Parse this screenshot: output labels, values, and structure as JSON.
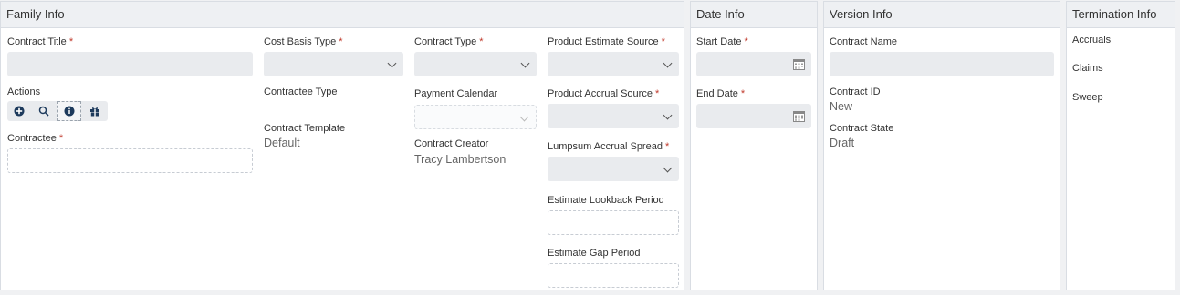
{
  "family": {
    "title": "Family Info",
    "contract_title_label": "Contract Title",
    "actions_label": "Actions",
    "contractee_label": "Contractee",
    "cost_basis_type_label": "Cost Basis Type",
    "contractee_type_label": "Contractee Type",
    "contractee_type_value": "-",
    "contract_template_label": "Contract Template",
    "contract_template_value": "Default",
    "contract_type_label": "Contract Type",
    "payment_calendar_label": "Payment Calendar",
    "contract_creator_label": "Contract Creator",
    "contract_creator_value": "Tracy Lambertson",
    "product_estimate_source_label": "Product Estimate Source",
    "product_accrual_source_label": "Product Accrual Source",
    "lumpsum_accrual_spread_label": "Lumpsum Accrual Spread",
    "estimate_lookback_period_label": "Estimate Lookback Period",
    "estimate_gap_period_label": "Estimate Gap Period"
  },
  "date": {
    "title": "Date Info",
    "start_date_label": "Start Date",
    "end_date_label": "End Date"
  },
  "version": {
    "title": "Version Info",
    "contract_name_label": "Contract Name",
    "contract_id_label": "Contract ID",
    "contract_id_value": "New",
    "contract_state_label": "Contract State",
    "contract_state_value": "Draft"
  },
  "termination": {
    "title": "Termination Info",
    "links": [
      "Accruals",
      "Claims",
      "Sweep"
    ]
  },
  "required_marker": "*",
  "icons": {
    "actions": [
      "plus-circle-icon",
      "search-icon",
      "info-icon",
      "gift-icon"
    ],
    "date_picker": "calendar-icon",
    "dropdown": "chevron-down-icon"
  },
  "colors": {
    "required": "#c0392b",
    "icon": "#1d3a5c"
  }
}
